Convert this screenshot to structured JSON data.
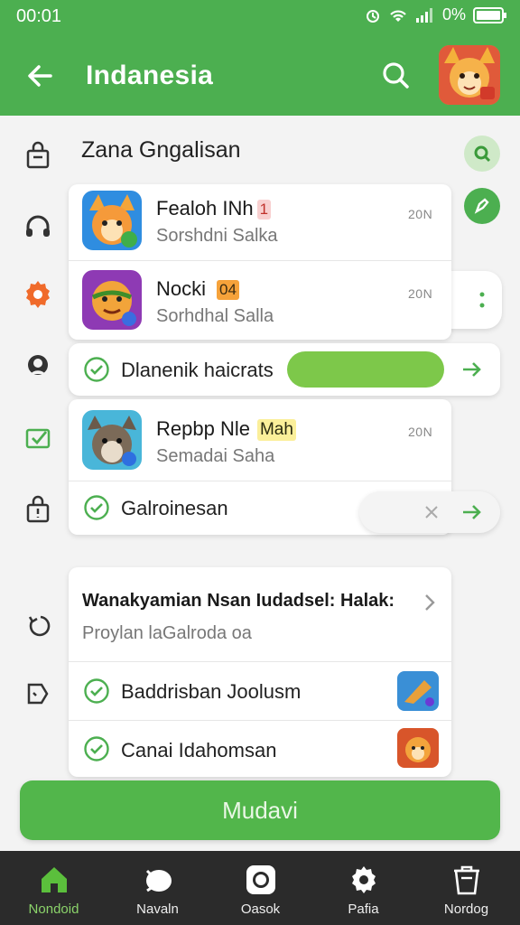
{
  "status_bar": {
    "time": "00:01",
    "battery": "0%"
  },
  "app_bar": {
    "title": "Indanesia"
  },
  "section": {
    "title": "Zana Gngalisan"
  },
  "apps": [
    {
      "name": "Fealoh INh",
      "badge": "1",
      "subtitle": "Sorshdni Salka",
      "size": "20N"
    },
    {
      "name": "Nocki",
      "badge": "04",
      "subtitle": "Sorhdhal Salla",
      "size": "20N"
    },
    {
      "name": "Repbp Nle",
      "badge": "Mah",
      "subtitle": "Semadai Saha",
      "size": "20N"
    }
  ],
  "status_rows": [
    {
      "label": "Dlanenik haicrats"
    },
    {
      "label": "Galroinesan"
    }
  ],
  "info_card": {
    "title": "Wanakyamian Nsan Iudadsel: Halak:",
    "subtitle": "Proylan laGalroda oa",
    "items": [
      {
        "label": "Baddrisban Joolusm"
      },
      {
        "label": "Canai Idahomsan"
      }
    ]
  },
  "cta": {
    "label": "Mudavi"
  },
  "bottom_nav": [
    {
      "label": "Nondoid",
      "icon": "home-icon",
      "active": true
    },
    {
      "label": "Navaln",
      "icon": "chat-icon",
      "active": false
    },
    {
      "label": "Oasok",
      "icon": "camera-icon",
      "active": false
    },
    {
      "label": "Pafia",
      "icon": "gear-icon",
      "active": false
    },
    {
      "label": "Nordog",
      "icon": "trash-icon",
      "active": false
    }
  ],
  "colors": {
    "primary": "#4caf50",
    "accent": "#7dc84a",
    "nav_bg": "#2b2b2b"
  }
}
